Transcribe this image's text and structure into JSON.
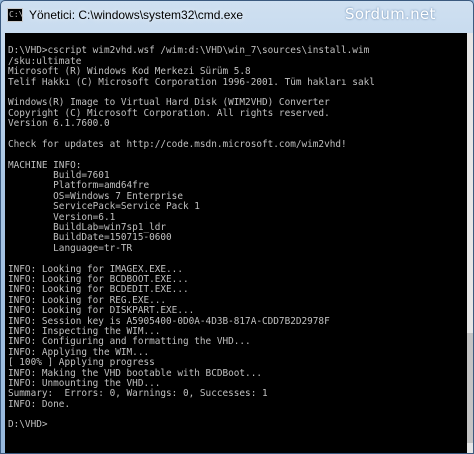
{
  "window": {
    "title": "Yönetici: C:\\windows\\system32\\cmd.exe",
    "watermark": "Sordum.net",
    "icon": "cmd-icon",
    "icon_glyph": "C:\\"
  },
  "colors": {
    "console_bg": "#000000",
    "console_fg": "#c0c0c0",
    "frame": "#a9c6e4"
  },
  "console": {
    "lines": [
      "",
      "D:\\VHD>cscript wim2vhd.wsf /wim:d:\\VHD\\win_7\\sources\\install.wim",
      "/sku:ultimate",
      "Microsoft (R) Windows Kod Merkezi Sürüm 5.8",
      "Telif Hakkı (C) Microsoft Corporation 1996-2001. Tüm hakları sakl",
      "",
      "Windows(R) Image to Virtual Hard Disk (WIM2VHD) Converter",
      "Copyright (C) Microsoft Corporation. All rights reserved.",
      "Version 6.1.7600.0",
      "",
      "Check for updates at http://code.msdn.microsoft.com/wim2vhd!",
      "",
      "MACHINE INFO:",
      "        Build=7601",
      "        Platform=amd64fre",
      "        OS=Windows 7 Enterprise",
      "        ServicePack=Service Pack 1",
      "        Version=6.1",
      "        BuildLab=win7sp1_ldr",
      "        BuildDate=150715-0600",
      "        Language=tr-TR",
      "",
      "INFO: Looking for IMAGEX.EXE...",
      "INFO: Looking for BCDBOOT.EXE...",
      "INFO: Looking for BCDEDIT.EXE...",
      "INFO: Looking for REG.EXE...",
      "INFO: Looking for DISKPART.EXE...",
      "INFO: Session key is A5905400-0D0A-4D3B-817A-CDD7B2D2978F",
      "INFO: Inspecting the WIM...",
      "INFO: Configuring and formatting the VHD...",
      "INFO: Applying the WIM...",
      "[ 100% ] Applying progress",
      "INFO: Making the VHD bootable with BCDBoot...",
      "INFO: Unmounting the VHD...",
      "Summary:  Errors: 0, Warnings: 0, Successes: 1",
      "INFO: Done.",
      "",
      "D:\\VHD>"
    ]
  }
}
